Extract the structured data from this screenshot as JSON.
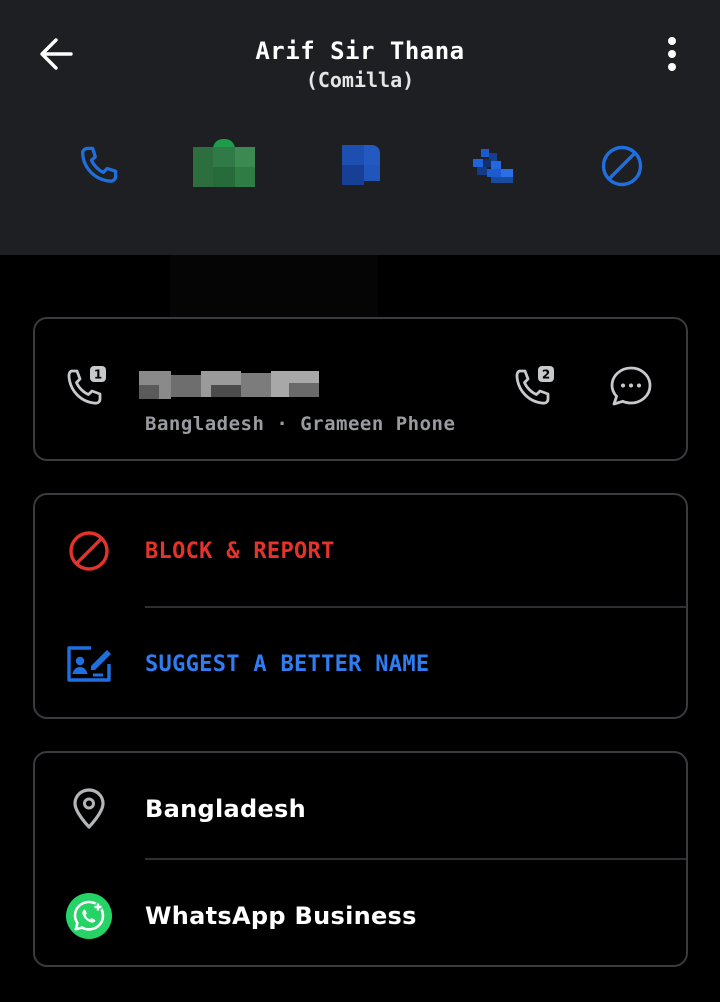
{
  "header": {
    "title": "Arif Sir Thana",
    "subtitle": "(Comilla)",
    "back_icon": "arrow-left-icon",
    "menu_icon": "more-vert-icon"
  },
  "actions": [
    {
      "name": "call",
      "icon": "phone-icon"
    },
    {
      "name": "whatsapp",
      "icon": "whatsapp-icon"
    },
    {
      "name": "video",
      "icon": "video-icon"
    },
    {
      "name": "add-contact",
      "icon": "add-contact-icon"
    },
    {
      "name": "block",
      "icon": "block-icon"
    }
  ],
  "number_card": {
    "carrier": "Bangladesh · Grameen Phone",
    "sim1_badge": "1",
    "sim2_badge": "2"
  },
  "options": {
    "block_label": "BLOCK & REPORT",
    "suggest_label": "SUGGEST A BETTER NAME"
  },
  "details": {
    "location": "Bangladesh",
    "app": "WhatsApp Business"
  },
  "colors": {
    "header_bg": "#1e1f22",
    "accent_blue": "#1f6fe0",
    "danger_red": "#e5322b",
    "whatsapp_green": "#25d366",
    "card_border": "#3a3b3e"
  }
}
